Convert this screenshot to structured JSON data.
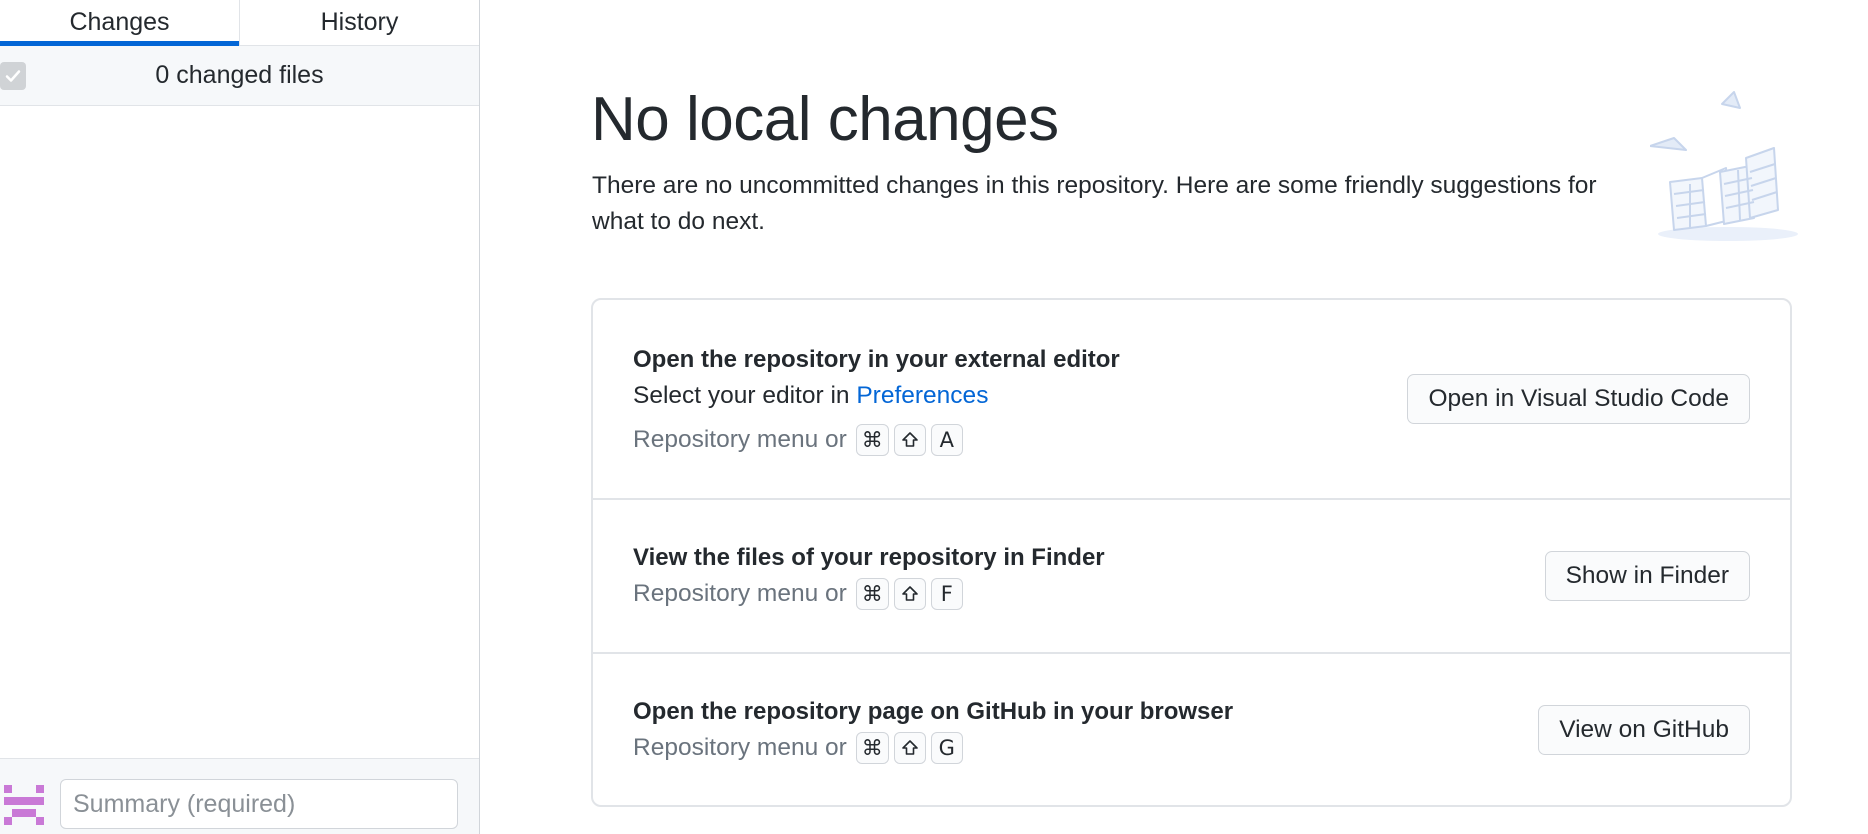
{
  "sidebar": {
    "tabs": [
      {
        "label": "Changes",
        "active": true
      },
      {
        "label": "History",
        "active": false
      }
    ],
    "changed_files_label": "0 changed files",
    "summary_placeholder": "Summary (required)"
  },
  "main": {
    "title": "No local changes",
    "subtitle": "There are no uncommitted changes in this repository. Here are some friendly suggestions for what to do next.",
    "suggestions": [
      {
        "title": "Open the repository in your external editor",
        "desc_prefix": "Select your editor in ",
        "desc_link": "Preferences",
        "shortcut_prefix": "Repository menu or",
        "keys": [
          "⌘",
          "shift-icon",
          "A"
        ],
        "button": "Open in Visual Studio Code"
      },
      {
        "title": "View the files of your repository in Finder",
        "shortcut_prefix": "Repository menu or",
        "keys": [
          "⌘",
          "shift-icon",
          "F"
        ],
        "button": "Show in Finder"
      },
      {
        "title": "Open the repository page on GitHub in your browser",
        "shortcut_prefix": "Repository menu or",
        "keys": [
          "⌘",
          "shift-icon",
          "G"
        ],
        "button": "View on GitHub"
      }
    ]
  },
  "colors": {
    "accent": "#0366d6",
    "border": "#e1e4e8",
    "muted_text": "#6a737d",
    "avatar": "#c979d6",
    "illustration": "#c7d5ec"
  }
}
